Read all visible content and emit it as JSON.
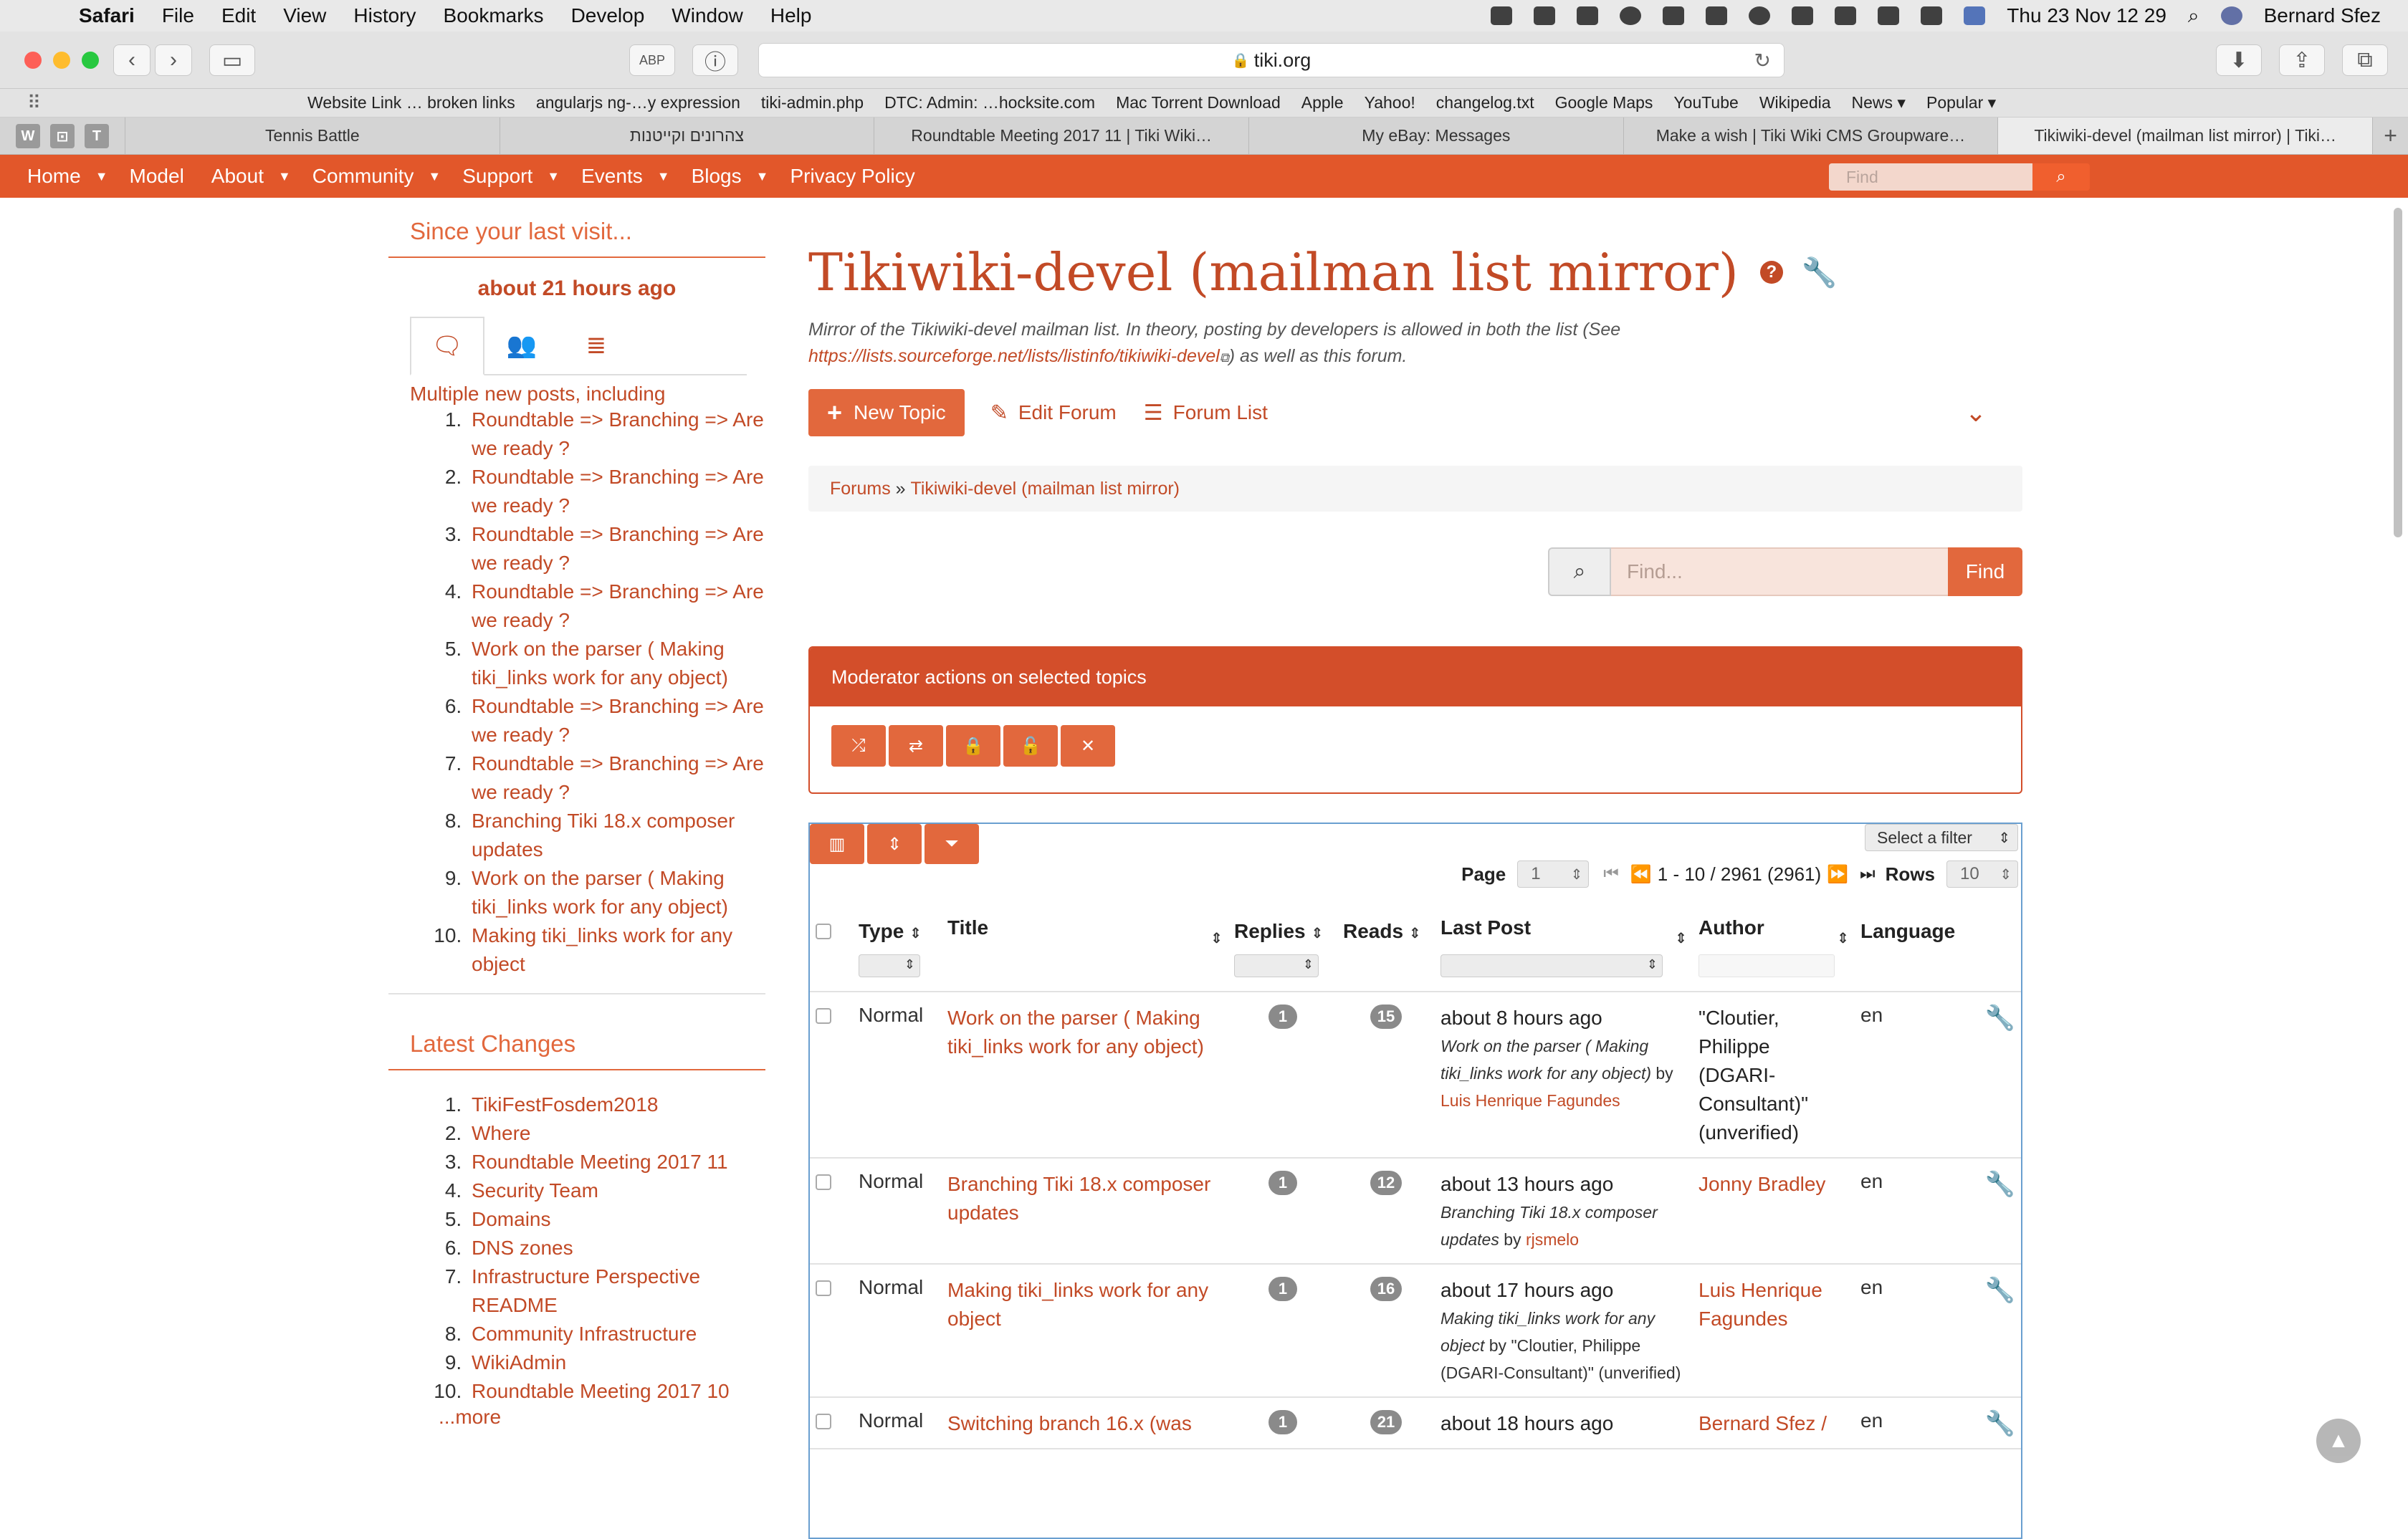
{
  "menubar": {
    "app": "Safari",
    "items": [
      "File",
      "Edit",
      "View",
      "History",
      "Bookmarks",
      "Develop",
      "Window",
      "Help"
    ],
    "datetime": "Thu 23 Nov  12 29",
    "user": "Bernard Sfez"
  },
  "browser": {
    "url": "tiki.org",
    "favorites": [
      "Website Link … broken links",
      "angularjs ng-…y expression",
      "tiki-admin.php",
      "DTC: Admin: …hocksite.com",
      "Mac Torrent Download",
      "Apple",
      "Yahoo!",
      "changelog.txt",
      "Google Maps",
      "YouTube",
      "Wikipedia",
      "News ▾",
      "Popular ▾"
    ],
    "pinned": [
      "W",
      "⊡",
      "T"
    ],
    "tabs": [
      "Tennis Battle",
      "צהרונים וקייטנות",
      "Roundtable Meeting 2017 11 | Tiki Wiki…",
      "My eBay: Messages",
      "Make a wish | Tiki Wiki CMS Groupware…",
      "Tikiwiki-devel (mailman list mirror) | Tiki…"
    ]
  },
  "sitenav": {
    "items": [
      "Home",
      "Model",
      "About",
      "Community",
      "Support",
      "Events",
      "Blogs",
      "Privacy Policy"
    ],
    "find_placeholder": "Find"
  },
  "sidebar": {
    "since_title": "Since your last visit...",
    "since_time": "about 21 hours ago",
    "multi_text": "Multiple new posts, including",
    "posts": [
      "Roundtable => Branching => Are we ready ?",
      "Roundtable => Branching => Are we ready ?",
      "Roundtable => Branching => Are we ready ?",
      "Roundtable => Branching => Are we ready ?",
      "Work on the parser ( Making tiki_links work for any object)",
      "Roundtable => Branching => Are we ready ?",
      "Roundtable => Branching => Are we ready ?",
      "Branching Tiki 18.x composer updates",
      "Work on the parser ( Making tiki_links work for any object)",
      "Making tiki_links work for any object"
    ],
    "latest_title": "Latest Changes",
    "latest": [
      "TikiFestFosdem2018",
      "Where",
      "Roundtable Meeting 2017 11",
      "Security Team",
      "Domains",
      "DNS zones",
      "Infrastructure Perspective README",
      "Community Infrastructure",
      "WikiAdmin",
      "Roundtable Meeting 2017 10"
    ],
    "more": "...more"
  },
  "main": {
    "title": "Tikiwiki-devel (mailman list mirror)",
    "desc_pre": "Mirror of the Tikiwiki-devel mailman list. In theory, posting by developers is allowed in both the list (See ",
    "desc_link": "https://lists.sourceforge.net/lists/listinfo/tikiwiki-devel",
    "desc_post": ") as well as this forum.",
    "new_topic": "New Topic",
    "edit_forum": "Edit Forum",
    "forum_list": "Forum List",
    "breadcrumb_root": "Forums",
    "breadcrumb_sep": " » ",
    "breadcrumb_current": "Tikiwiki-devel (mailman list mirror)",
    "search_placeholder": "Find...",
    "search_btn": "Find",
    "mod_title": "Moderator actions on selected topics",
    "filter_select": "Select a filter",
    "page_label": "Page",
    "page_value": "1",
    "range": "1 - 10 / 2961 (2961)",
    "rows_label": "Rows",
    "rows_value": "10",
    "columns": [
      "Type",
      "Title",
      "Replies",
      "Reads",
      "Last Post",
      "Author",
      "Language"
    ],
    "topics": [
      {
        "type": "Normal",
        "title": "Work on the parser ( Making tiki_links work for any object)",
        "replies": "1",
        "reads": "15",
        "lp_time": "about 8 hours ago",
        "lp_title": "Work on the parser ( Making tiki_links work for any object)",
        "lp_by": "by",
        "lp_user": "Luis Henrique Fagundes",
        "author": "\"Cloutier, Philippe (DGARI-Consultant)\" (unverified)",
        "lang": "en"
      },
      {
        "type": "Normal",
        "title": "Branching Tiki 18.x composer updates",
        "replies": "1",
        "reads": "12",
        "lp_time": "about 13 hours ago",
        "lp_title": "Branching Tiki 18.x composer updates",
        "lp_by": "by",
        "lp_user": "rjsmelo",
        "author": "Jonny Bradley",
        "lang": "en"
      },
      {
        "type": "Normal",
        "title": "Making tiki_links work for any object",
        "replies": "1",
        "reads": "16",
        "lp_time": "about 17 hours ago",
        "lp_title": "Making tiki_links work for any object",
        "lp_by": "by \"Cloutier, Philippe (DGARI-Consultant)\" (unverified)",
        "lp_user": "",
        "author": "Luis Henrique Fagundes",
        "lang": "en"
      },
      {
        "type": "Normal",
        "title": "Switching branch 16.x (was",
        "replies": "1",
        "reads": "21",
        "lp_time": "about 18 hours ago",
        "lp_title": "",
        "lp_by": "",
        "lp_user": "",
        "author": "Bernard Sfez /",
        "lang": "en"
      }
    ]
  }
}
